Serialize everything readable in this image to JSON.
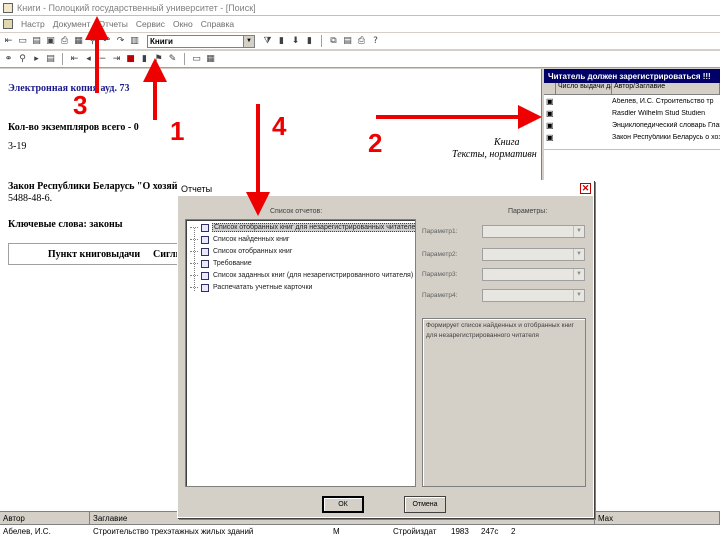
{
  "window": {
    "title": "Книги - Полоцкий государственный университет - [Поиск]"
  },
  "menu": {
    "items": [
      "Настр",
      "Документ",
      "Отчеты",
      "Сервис",
      "Окно",
      "Справка"
    ]
  },
  "toolbar": {
    "combo_value": "Книги"
  },
  "document": {
    "electronic_copy": "Электронная копия ауд. 73",
    "copies_label": "Кол-во экземпляров всего - 0",
    "range": "3-19",
    "law": "Закон Республики Беларусь \"О хозяй",
    "isbn": "5488-48-6.",
    "keywords": "Ключевые слова: законы",
    "issue_point": "Пункт книговыдачи",
    "issue_point_2": "Сиглы",
    "right_type": "Книга",
    "right_series": "Тексты, нормативн"
  },
  "right_panel": {
    "header": "Читатель должен зарегистрироваться !!!",
    "col1": "Номер",
    "col2": "Число выдачи дата",
    "col3": "Автор/Заглавие",
    "rows": [
      {
        "author": "Абелев, И.С. Строительство тр"
      },
      {
        "author": "Rasdler Wilhelm Stud Studien"
      },
      {
        "author": "Энциклопедический словарь Глав"
      },
      {
        "author": "Закон Республики Беларусь о хоз"
      }
    ]
  },
  "bottom_grid": {
    "headers": [
      "Автор",
      "Заглавие",
      "Max"
    ],
    "row": {
      "author": "Абелев, И.С.",
      "title": "Строительство трехэтажных жилых зданий",
      "col3": "М",
      "col4": "Стройиздат",
      "year": "1983",
      "pages": "247с",
      "n": "2"
    }
  },
  "dialog": {
    "title": "Отчеты",
    "list_label": "Список отчетов:",
    "params_label": "Параметры:",
    "reports": [
      "Список отобранных книг для незарегистрированных читателей",
      "Список найденных книг",
      "Список отобранных книг",
      "Требование",
      "Список заданных книг (для незарегистрированного читателя)",
      "Распечатать учетные карточки"
    ],
    "params": [
      "Параметр1:",
      "Параметр2:",
      "Параметр3:",
      "Параметр4:"
    ],
    "description": "Формирует список найденных и отобранных книг для незарегистрированного читателя",
    "ok_label": "ОК",
    "cancel_label": "Отмена"
  },
  "annotations": {
    "labels": [
      "1",
      "2",
      "3",
      "4"
    ],
    "color": "#ee0000"
  }
}
